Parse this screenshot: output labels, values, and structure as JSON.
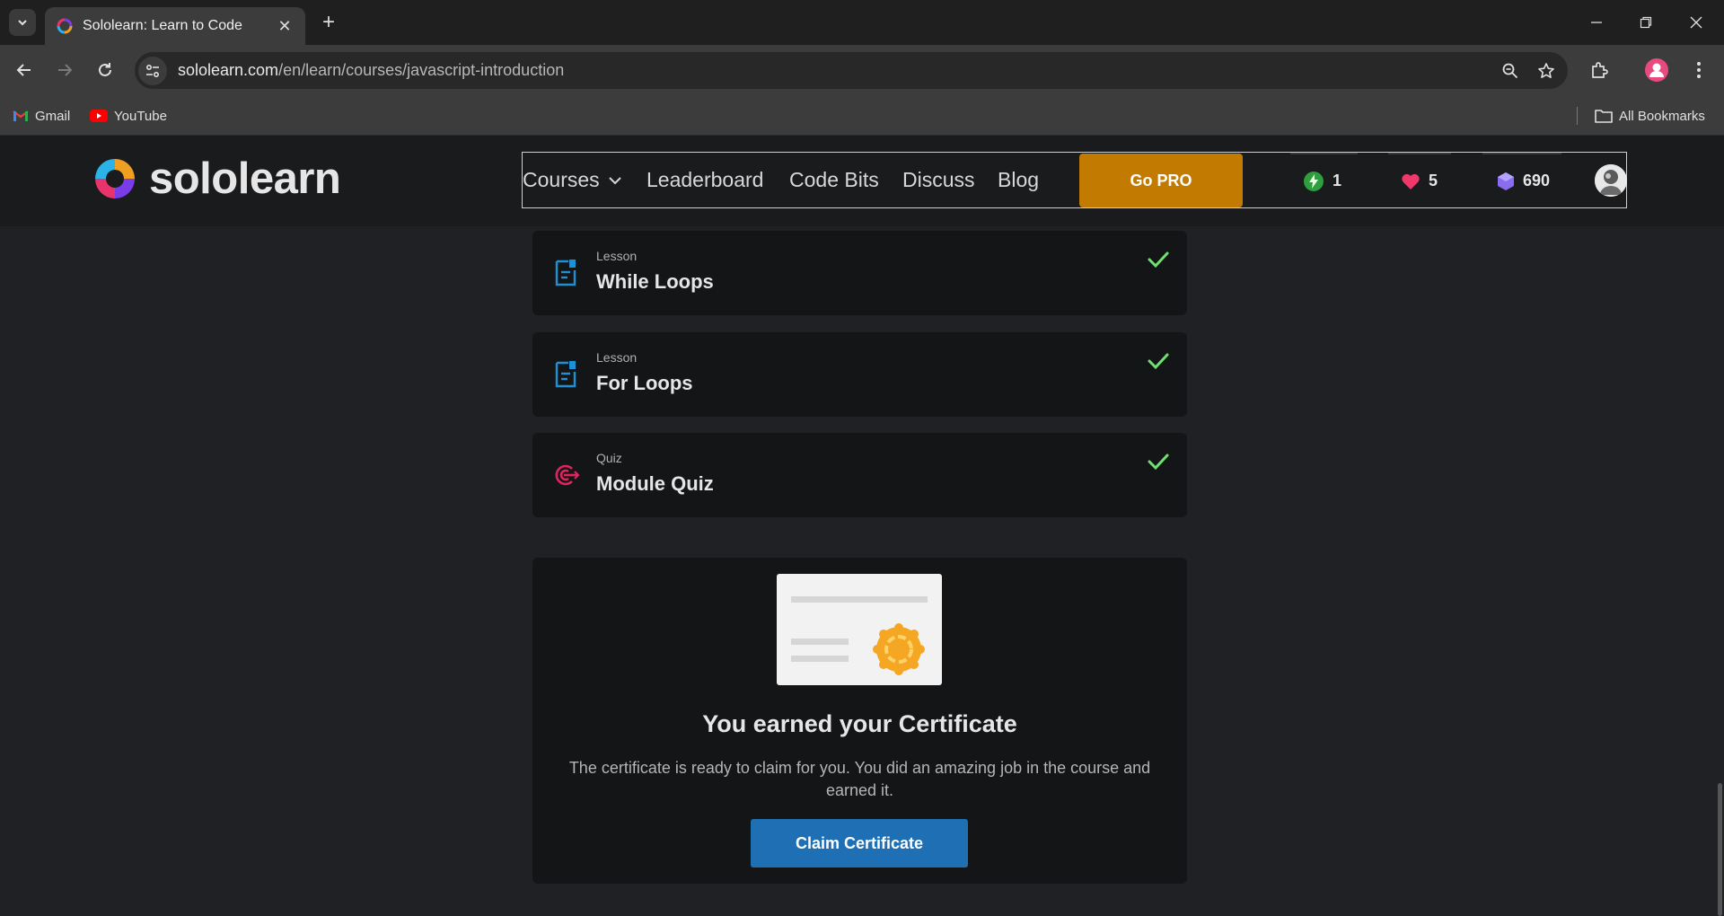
{
  "browser": {
    "tab_title": "Sololearn: Learn to Code",
    "url_host": "sololearn.com",
    "url_path": "/en/learn/courses/javascript-introduction",
    "bookmarks": [
      {
        "label": "Gmail",
        "icon": "gmail-icon"
      },
      {
        "label": "YouTube",
        "icon": "youtube-icon"
      }
    ],
    "all_bookmarks_label": "All Bookmarks"
  },
  "header": {
    "logo_text": "sololearn",
    "nav": {
      "courses": "Courses",
      "leaderboard": "Leaderboard",
      "code_bits": "Code Bits",
      "discuss": "Discuss",
      "blog": "Blog"
    },
    "go_pro_label": "Go PRO",
    "stats": {
      "streak": "1",
      "hearts": "5",
      "gems": "690"
    }
  },
  "lessons": [
    {
      "type": "Lesson",
      "title": "While Loops",
      "icon": "lesson-icon",
      "completed": true
    },
    {
      "type": "Lesson",
      "title": "For Loops",
      "icon": "lesson-icon",
      "completed": true
    },
    {
      "type": "Quiz",
      "title": "Module Quiz",
      "icon": "quiz-target-icon",
      "completed": true
    }
  ],
  "certificate": {
    "title": "You earned your Certificate",
    "description": "The certificate is ready to claim for you. You did an amazing job in the course and earned it.",
    "button_label": "Claim Certificate"
  },
  "colors": {
    "accent_blue": "#1f6fb5",
    "go_pro": "#c27b00",
    "check_green": "#6ee26e",
    "lesson_icon_blue": "#1e90d6",
    "quiz_icon_red": "#e0245e"
  }
}
